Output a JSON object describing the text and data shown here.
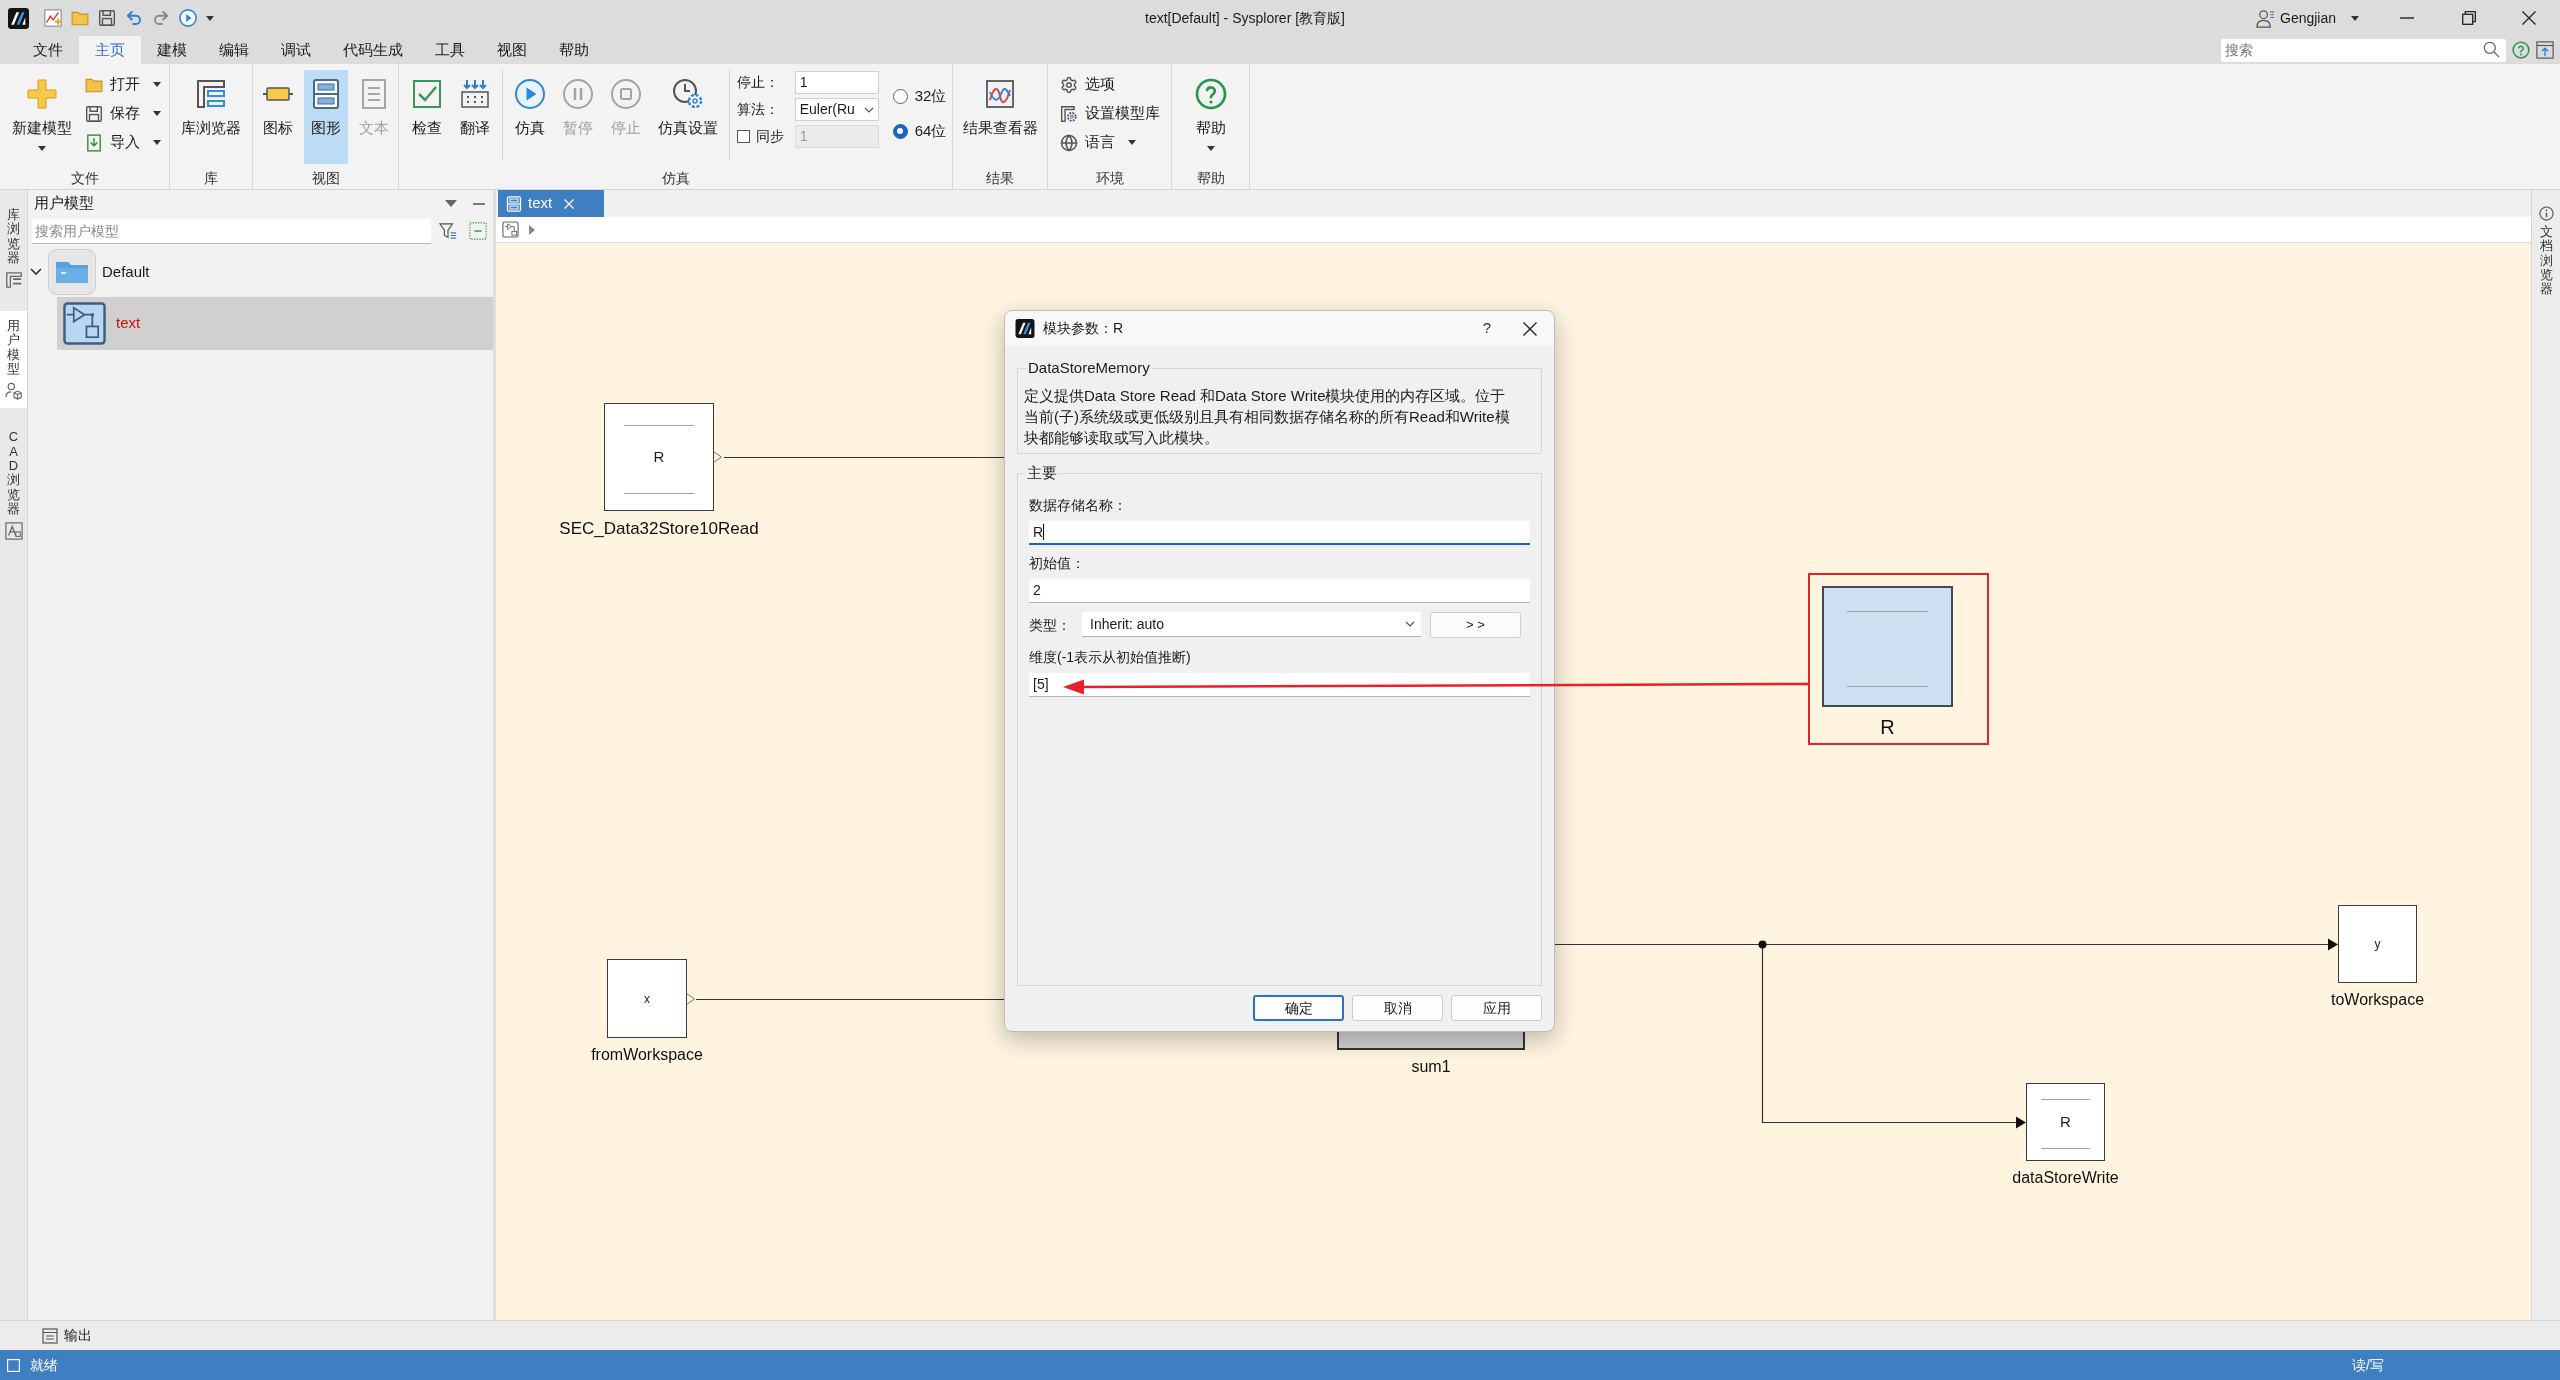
{
  "window": {
    "title": "text[Default] - Sysplorer [教育版]",
    "user": "Gengjian"
  },
  "menu": [
    {
      "label": "文件",
      "selected": false
    },
    {
      "label": "主页",
      "selected": true
    },
    {
      "label": "建模",
      "selected": false
    },
    {
      "label": "编辑",
      "selected": false
    },
    {
      "label": "调试",
      "selected": false
    },
    {
      "label": "代码生成",
      "selected": false
    },
    {
      "label": "工具",
      "selected": false
    },
    {
      "label": "视图",
      "selected": false
    },
    {
      "label": "帮助",
      "selected": false
    }
  ],
  "search": {
    "placeholder": "搜索"
  },
  "ribbon": [
    {
      "label": "文件",
      "sections": [
        [
          {
            "kind": "large",
            "label": "新建模型",
            "dropdown": true,
            "disabled": false
          },
          {
            "kind": "small",
            "label": "打开",
            "dropdown": true,
            "disabled": false
          },
          {
            "kind": "small",
            "label": "保存",
            "dropdown": true,
            "disabled": false
          },
          {
            "kind": "small",
            "label": "导入",
            "dropdown": true,
            "disabled": false
          }
        ]
      ]
    },
    {
      "label": "库",
      "sections": [
        [
          {
            "kind": "large",
            "label": "库浏览器",
            "dropdown": false,
            "disabled": false
          }
        ]
      ]
    },
    {
      "label": "视图",
      "sections": [
        [
          {
            "kind": "large",
            "label": "图标",
            "dropdown": false,
            "disabled": false,
            "selected": false
          },
          {
            "kind": "large",
            "label": "图形",
            "dropdown": false,
            "disabled": false,
            "selected": true
          },
          {
            "kind": "large",
            "label": "文本",
            "dropdown": false,
            "disabled": true,
            "selected": false
          }
        ]
      ]
    },
    {
      "label": "仿真",
      "sections": [
        [
          {
            "kind": "large",
            "label": "检查",
            "dropdown": false,
            "disabled": false
          },
          {
            "kind": "large",
            "label": "翻译",
            "dropdown": false,
            "disabled": false
          }
        ],
        [
          {
            "kind": "large",
            "label": "仿真",
            "dropdown": false,
            "disabled": false
          },
          {
            "kind": "large",
            "label": "暂停",
            "dropdown": false,
            "disabled": true
          },
          {
            "kind": "large",
            "label": "停止",
            "dropdown": false,
            "disabled": true
          },
          {
            "kind": "large",
            "label": "仿真设置",
            "dropdown": false,
            "disabled": false
          }
        ]
      ],
      "fields": [
        {
          "kind": "input",
          "label": "停止：",
          "value": "1",
          "disabled": false
        },
        {
          "kind": "select",
          "label": "算法：",
          "value": "Euler(Ru",
          "disabled": false
        },
        {
          "kind": "checkbox-input",
          "label": "同步",
          "checked": false,
          "value": "1",
          "disabled": true
        }
      ],
      "radios": [
        {
          "label": "32位",
          "selected": false
        },
        {
          "label": "64位",
          "selected": true
        }
      ]
    },
    {
      "label": "结果",
      "sections": [
        [
          {
            "kind": "large",
            "label": "结果查看器",
            "dropdown": false,
            "disabled": false
          }
        ]
      ]
    },
    {
      "label": "环境",
      "sections": [
        [
          {
            "kind": "small",
            "label": "选项",
            "dropdown": false,
            "disabled": false
          },
          {
            "kind": "small",
            "label": "设置模型库",
            "dropdown": false,
            "disabled": false
          },
          {
            "kind": "small",
            "label": "语言",
            "dropdown": true,
            "disabled": false
          }
        ]
      ]
    },
    {
      "label": "帮助",
      "sections": [
        [
          {
            "kind": "large",
            "label": "帮助",
            "dropdown": true,
            "disabled": false
          }
        ]
      ]
    }
  ],
  "side_tabs": [
    {
      "label": "库浏览器",
      "selected": false
    },
    {
      "label": "用户模型",
      "selected": true
    },
    {
      "label": "CAD 浏览器",
      "selected": false
    }
  ],
  "model_panel": {
    "title": "用户模型",
    "search": {
      "placeholder": "搜索用户模型"
    },
    "tree": [
      {
        "label": "Default",
        "expanded": true,
        "selected": false,
        "color": "#1b1b1b",
        "children": [
          {
            "label": "text",
            "selected": true,
            "color": "#cc1414"
          }
        ]
      }
    ]
  },
  "editor": {
    "tabs": [
      {
        "label": "text",
        "selected": true
      }
    ],
    "canvas": {
      "blocks": [
        {
          "kind": "store-read",
          "name": "SEC_Data32Store10Read",
          "label": "R",
          "selected": false,
          "highlighted": false
        },
        {
          "kind": "store-memory",
          "name": "R",
          "selected": true,
          "highlighted": true
        },
        {
          "kind": "sink",
          "name": "toWorkspace",
          "label": "y",
          "selected": false,
          "highlighted": false
        },
        {
          "kind": "source",
          "name": "fromWorkspace",
          "label": "x",
          "selected": false,
          "highlighted": false
        },
        {
          "kind": "sum",
          "name": "sum1",
          "selected": false,
          "highlighted": false
        },
        {
          "kind": "store-write",
          "name": "dataStoreWrite",
          "label": "R",
          "selected": false,
          "highlighted": false
        }
      ]
    }
  },
  "right_tabs": [
    {
      "label": "文档浏览器",
      "selected": false
    }
  ],
  "dialog": {
    "title": "模块参数：R",
    "help_button": "?",
    "block_type": "DataStoreMemory",
    "description": "定义提供Data Store Read 和Data Store Write模块使用的内存区域。位于当前(子)系统级或更低级别且具有相同数据存储名称的所有Read和Write模块都能够读取或写入此模块。",
    "section": "主要",
    "fields": [
      {
        "kind": "text",
        "label": "数据存储名称：",
        "value": "R",
        "focused": true
      },
      {
        "kind": "text",
        "label": "初始值：",
        "value": "2",
        "focused": false
      },
      {
        "kind": "select",
        "label": "类型：",
        "value": "Inherit: auto",
        "button": "> >",
        "focused": false
      },
      {
        "kind": "text",
        "label": "维度(-1表示从初始值推断)",
        "value": "[5]",
        "focused": false
      }
    ],
    "buttons": [
      {
        "label": "确定",
        "default": true
      },
      {
        "label": "取消",
        "default": false
      },
      {
        "label": "应用",
        "default": false
      }
    ]
  },
  "output_panel": {
    "label": "输出"
  },
  "status_bar": {
    "left": "就绪",
    "right": "读/写"
  }
}
